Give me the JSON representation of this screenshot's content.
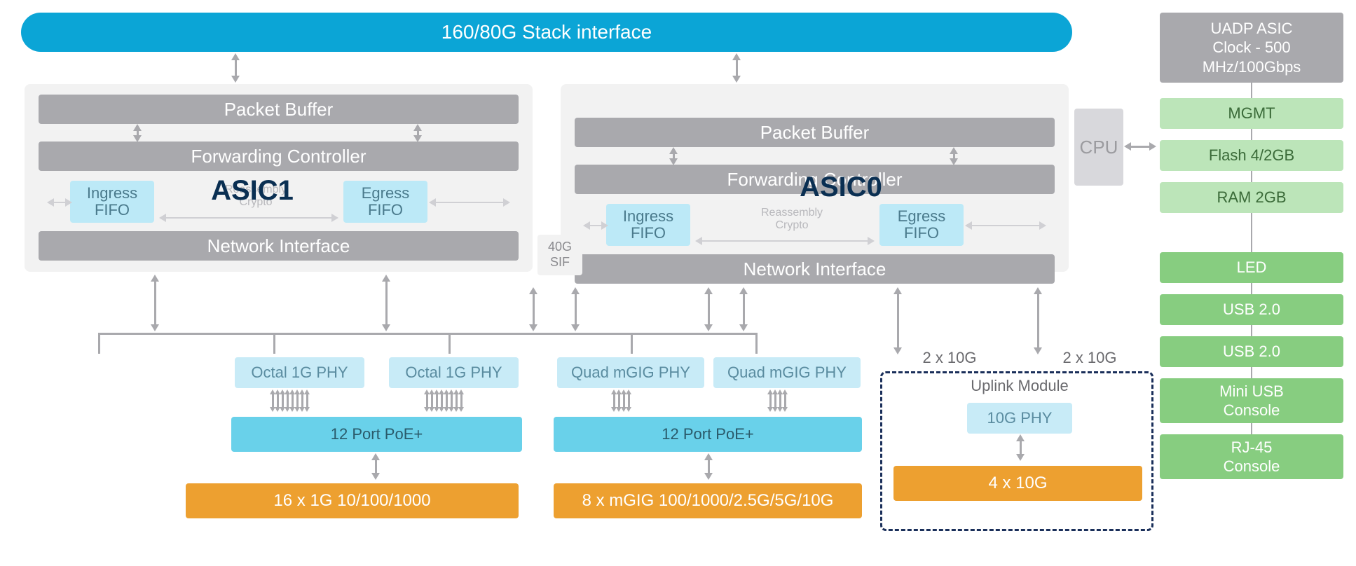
{
  "stack_interface": "160/80G Stack interface",
  "sif": "40G\nSIF",
  "asic1": {
    "title": "ASIC1",
    "packet_buffer": "Packet Buffer",
    "fwd_ctrl": "Forwarding Controller",
    "ingress": "Ingress\nFIFO",
    "egress": "Egress\nFIFO",
    "reassembly": "Reassembly\nCrypto",
    "net_if": "Network Interface"
  },
  "asic0": {
    "title": "ASIC0",
    "packet_buffer": "Packet Buffer",
    "fwd_ctrl": "Forwarding Controller",
    "ingress": "Ingress\nFIFO",
    "egress": "Egress\nFIFO",
    "reassembly": "Reassembly\nCrypto",
    "net_if": "Network Interface"
  },
  "cpu": "CPU",
  "phy": {
    "octal1": "Octal 1G PHY",
    "octal2": "Octal 1G PHY",
    "quad1": "Quad mGIG PHY",
    "quad2": "Quad mGIG PHY"
  },
  "poe1": "12 Port PoE+",
  "poe2": "12 Port PoE+",
  "ports1": "16 x 1G 10/100/1000",
  "ports2": "8 x mGIG 100/1000/2.5G/5G/10G",
  "uplink": {
    "title": "Uplink Module",
    "phy": "10G PHY",
    "ports": "4 x 10G",
    "link1": "2 x 10G",
    "link2": "2 x 10G"
  },
  "side": {
    "clock": "UADP ASIC\nClock - 500\nMHz/100Gbps",
    "mgmt": "MGMT",
    "flash": "Flash 4/2GB",
    "ram": "RAM 2GB",
    "led": "LED",
    "usb1": "USB 2.0",
    "usb2": "USB 2.0",
    "miniusb": "Mini USB\nConsole",
    "rj45": "RJ-45\nConsole"
  }
}
